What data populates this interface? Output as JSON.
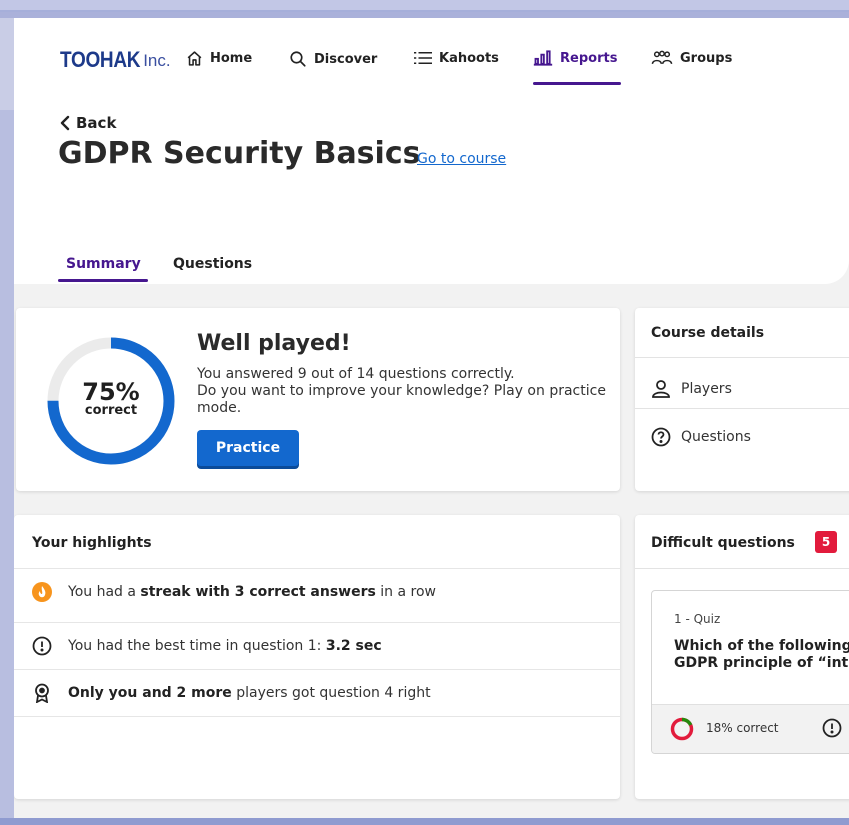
{
  "brand": {
    "main": "TOOHAK",
    "sub": "Inc."
  },
  "nav": {
    "items": [
      {
        "label": "Home",
        "icon": "home-icon"
      },
      {
        "label": "Discover",
        "icon": "search-icon"
      },
      {
        "label": "Kahoots",
        "icon": "list-icon"
      },
      {
        "label": "Reports",
        "icon": "bar-chart-icon",
        "active": true
      },
      {
        "label": "Groups",
        "icon": "groups-icon"
      }
    ]
  },
  "page": {
    "back_label": "Back",
    "title": "GDPR Security Basics",
    "course_link": "Go to course"
  },
  "tabs": [
    {
      "label": "Summary",
      "active": true
    },
    {
      "label": "Questions",
      "active": false
    }
  ],
  "summary": {
    "percent_label": "75%",
    "percent_value": 75,
    "correct_label": "correct",
    "heading": "Well played!",
    "line1": "You answered 9 out of 14 questions correctly.",
    "line2": "Do you want to improve your knowledge? Play on practice mode.",
    "practice_button": "Practice"
  },
  "course_details": {
    "title": "Course details",
    "rows": [
      {
        "label": "Players",
        "icon": "person-icon"
      },
      {
        "label": "Questions",
        "icon": "question-circle-icon"
      }
    ]
  },
  "highlights": {
    "title": "Your highlights",
    "items": [
      {
        "icon": "flame-icon",
        "pre": "You had a ",
        "bold": "streak with 3 correct answers",
        "post": " in a row"
      },
      {
        "icon": "clock-icon",
        "pre": "You had the best time in question 1: ",
        "bold": "3.2 sec",
        "post": ""
      },
      {
        "icon": "award-icon",
        "pre": "",
        "bold": "Only you and 2 more",
        "post": " players got question 4 right"
      }
    ]
  },
  "difficult": {
    "title": "Difficult questions",
    "count": "5",
    "question": {
      "type": "1 - Quiz",
      "text_line1": "Which of the following",
      "text_line2": "GDPR principle of “int",
      "correct_label": "18% correct",
      "correct_value": 18
    }
  },
  "colors": {
    "accent_purple": "#46178f",
    "primary_blue": "#1368ce",
    "badge_red": "#e21b3c",
    "flame_orange": "#f7941d",
    "donut_green": "#26890c"
  }
}
